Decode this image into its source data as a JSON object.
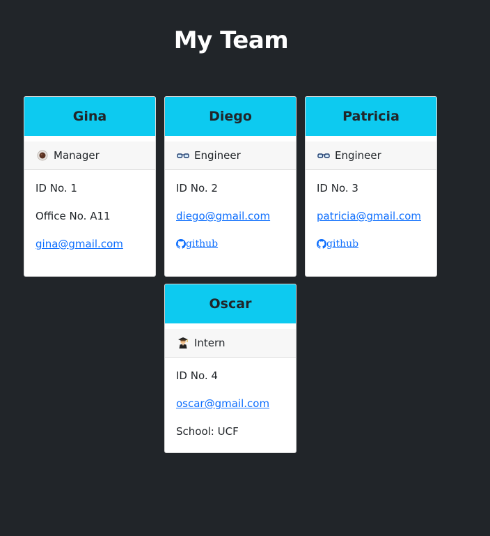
{
  "header": {
    "title": "My Team"
  },
  "colors": {
    "background": "#212529",
    "card_header": "#0dcaf0",
    "link": "#0d6efd"
  },
  "cards": [
    {
      "name": "Gina",
      "role": "Manager",
      "role_icon": "coffee-icon",
      "id": "ID No. 1",
      "office": "Office No. A11",
      "email": "gina@gmail.com"
    },
    {
      "name": "Diego",
      "role": "Engineer",
      "role_icon": "glasses-icon",
      "id": "ID No. 2",
      "email": "diego@gmail.com",
      "github": "github"
    },
    {
      "name": "Patricia",
      "role": "Engineer",
      "role_icon": "glasses-icon",
      "id": "ID No. 3",
      "email": "patricia@gmail.com",
      "github": "github"
    },
    {
      "name": "Oscar",
      "role": "Intern",
      "role_icon": "graduate-icon",
      "id": "ID No. 4",
      "email": "oscar@gmail.com",
      "school": "School: UCF"
    }
  ]
}
